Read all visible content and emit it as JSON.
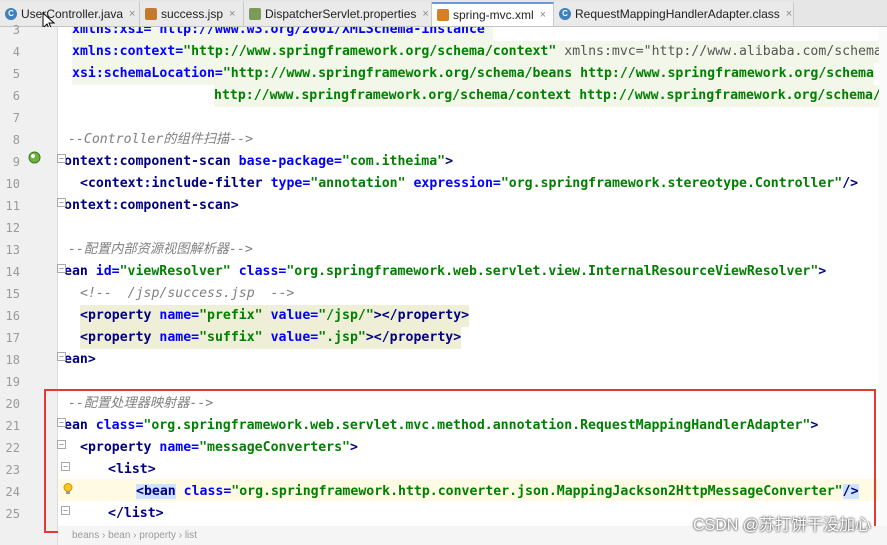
{
  "tabs": [
    {
      "label": "UserController.java",
      "icon": "java-class-icon",
      "active": false
    },
    {
      "label": "success.jsp",
      "icon": "jsp-file-icon",
      "active": false
    },
    {
      "label": "DispatcherServlet.properties",
      "icon": "properties-file-icon",
      "active": false
    },
    {
      "label": "spring-mvc.xml",
      "icon": "xml-file-icon",
      "active": true
    },
    {
      "label": "RequestMappingHandlerAdapter.class",
      "icon": "class-file-icon",
      "active": false
    }
  ],
  "close_glyph": "×",
  "line_numbers": [
    "3",
    "4",
    "5",
    "6",
    "7",
    "8",
    "9",
    "10",
    "11",
    "12",
    "13",
    "14",
    "15",
    "16",
    "17",
    "18",
    "19",
    "20",
    "21",
    "22",
    "23",
    "24",
    "25"
  ],
  "code": {
    "l3": "xmlns:xsi=\"http://www.w3.org/2001/XMLSchema-instance\"",
    "l4a": "xmlns:context=",
    "l4b": "\"http://www.springframework.org/schema/context\"",
    "l4c": " xmlns:mvc=",
    "l4d": "\"http://www.alibaba.com/schema",
    "l5a": "xsi:schemaLocation=",
    "l5b": "\"http://www.springframework.org/schema/beans http://www.springframework.org/schema",
    "l6": "http://www.springframework.org/schema/context http://www.springframework.org/schema/",
    "l8": "--Controller的组件扫描-->",
    "l9a": "ontext:component-scan",
    "l9b": " base-package=",
    "l9c": "\"com.itheima\"",
    "l9d": ">",
    "l10a": "<context:include-filter",
    "l10b": " type=",
    "l10c": "\"annotation\"",
    "l10d": " expression=",
    "l10e": "\"org.springframework.stereotype.Controller\"",
    "l10f": "/>",
    "l11": "ontext:component-scan>",
    "l13": "--配置内部资源视图解析器-->",
    "l14a": "ean",
    "l14b": " id=",
    "l14c": "\"viewResolver\"",
    "l14d": " class=",
    "l14e": "\"org.springframework.web.servlet.view.InternalResourceViewResolver\"",
    "l14f": ">",
    "l15": "<!--  /jsp/success.jsp  -->",
    "l16a": "<property",
    "l16b": " name=",
    "l16c": "\"prefix\"",
    "l16d": " value=",
    "l16e": "\"/jsp/\"",
    "l16f": "></property>",
    "l17a": "<property",
    "l17b": " name=",
    "l17c": "\"suffix\"",
    "l17d": " value=",
    "l17e": "\".jsp\"",
    "l17f": "></property>",
    "l18": "ean>",
    "l20": "--配置处理器映射器-->",
    "l21a": "ean",
    "l21b": " class=",
    "l21c": "\"org.springframework.web.servlet.mvc.method.annotation.RequestMappingHandlerAdapter\"",
    "l21d": ">",
    "l22a": "<property",
    "l22b": " name=",
    "l22c": "\"messageConverters\"",
    "l22d": ">",
    "l23": "<list>",
    "l24a": "<bean",
    "l24b": " class=",
    "l24c": "\"org.springframework.http.converter.json.MappingJackson2HttpMessageConverter\"",
    "l24d": "/>",
    "l25": "</list>"
  },
  "breadcrumb": "beans  ›  bean  ›  property  ›  list",
  "watermark": "CSDN @苏打饼干没加心",
  "colors": {
    "tag": "#000080",
    "attribute": "#0000ff",
    "value": "#008000",
    "comment": "#808080",
    "highlight_box": "#e53935"
  }
}
